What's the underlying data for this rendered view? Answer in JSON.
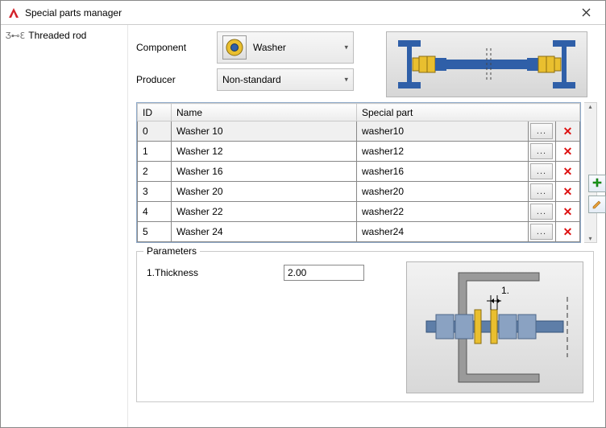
{
  "window": {
    "title": "Special parts manager"
  },
  "tree": {
    "items": [
      {
        "label": "Threaded rod"
      }
    ]
  },
  "form": {
    "component_label": "Component",
    "component_value": "Washer",
    "producer_label": "Producer",
    "producer_value": "Non-standard"
  },
  "grid": {
    "headers": {
      "id": "ID",
      "name": "Name",
      "special": "Special part"
    },
    "rows": [
      {
        "id": "0",
        "name": "Washer 10",
        "special": "washer10",
        "selected": true
      },
      {
        "id": "1",
        "name": "Washer 12",
        "special": "washer12",
        "selected": false
      },
      {
        "id": "2",
        "name": "Washer 16",
        "special": "washer16",
        "selected": false
      },
      {
        "id": "3",
        "name": "Washer 20",
        "special": "washer20",
        "selected": false
      },
      {
        "id": "4",
        "name": "Washer 22",
        "special": "washer22",
        "selected": false
      },
      {
        "id": "5",
        "name": "Washer 24",
        "special": "washer24",
        "selected": false
      }
    ],
    "browse_label": "..."
  },
  "parameters": {
    "legend": "Parameters",
    "items": [
      {
        "label": "1.Thickness",
        "value": "2.00"
      }
    ],
    "dim_label": "1."
  },
  "colors": {
    "accent_blue": "#2f5fa8",
    "accent_yellow": "#e9bf2f",
    "delete_red": "#d11"
  }
}
